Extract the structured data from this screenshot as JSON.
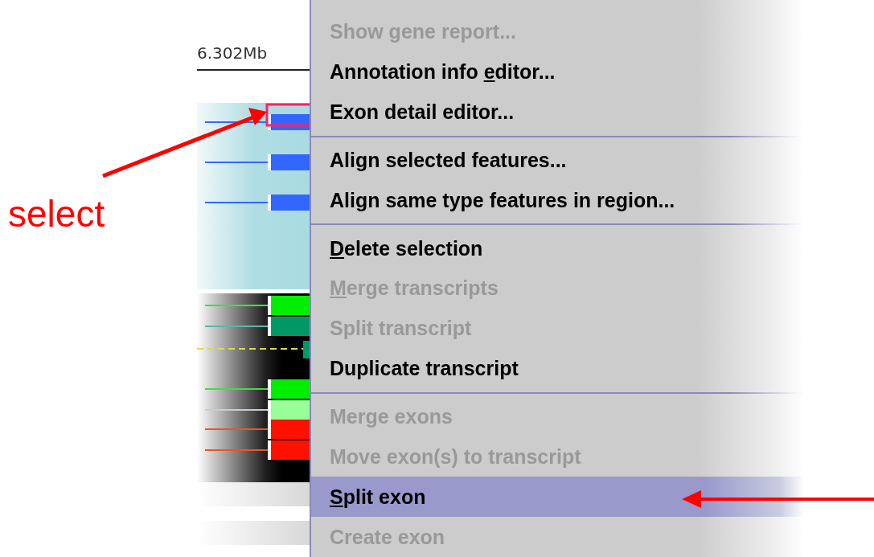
{
  "annotation": {
    "label": "select"
  },
  "ruler": {
    "label": "6.302Mb"
  },
  "menu": {
    "groups": [
      [
        {
          "label": "Show gene report...",
          "disabled": true,
          "selected": false
        },
        {
          "before": "Annotation info ",
          "key": "e",
          "after": "ditor...",
          "disabled": false,
          "selected": false
        },
        {
          "label": "Exon detail editor...",
          "disabled": false,
          "selected": false
        }
      ],
      [
        {
          "label": "Align selected features...",
          "disabled": false,
          "selected": false
        },
        {
          "label": "Align same type features in region...",
          "disabled": false,
          "selected": false
        }
      ],
      [
        {
          "key": "D",
          "after": "elete selection",
          "disabled": false,
          "selected": false
        },
        {
          "key": "M",
          "after": "erge transcripts",
          "disabled": true,
          "selected": false
        },
        {
          "label": "Split transcript",
          "disabled": true,
          "selected": false
        },
        {
          "label": "Duplicate transcript",
          "disabled": false,
          "selected": false
        }
      ],
      [
        {
          "label": "Merge exons",
          "disabled": true,
          "selected": false
        },
        {
          "label": "Move exon(s) to transcript",
          "disabled": true,
          "selected": false
        },
        {
          "key": "S",
          "after": "plit exon",
          "disabled": false,
          "selected": true
        },
        {
          "label": "Create exon",
          "disabled": true,
          "selected": false
        }
      ]
    ]
  }
}
